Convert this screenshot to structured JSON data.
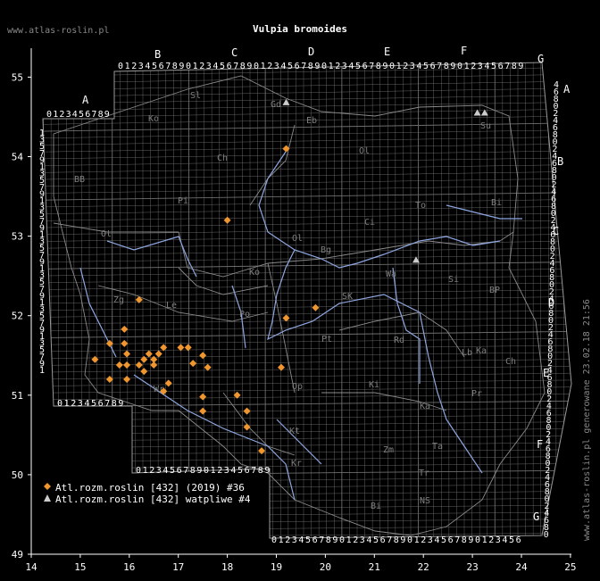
{
  "site": "www.atlas-roslin.pl",
  "title": "Vulpia bromoides",
  "generated": "www.atlas-roslin.pl generowane 23.02.18 21:56",
  "axes": {
    "x_ticks": [
      "14",
      "15",
      "16",
      "17",
      "18",
      "19",
      "20",
      "21",
      "22",
      "23",
      "24",
      "25"
    ],
    "y_ticks": [
      "49",
      "50",
      "51",
      "52",
      "53",
      "54",
      "55"
    ]
  },
  "grid": {
    "column_letters": [
      "A",
      "B",
      "C",
      "D",
      "E",
      "F",
      "G"
    ],
    "row_letters": [
      "A",
      "B",
      "C",
      "D",
      "E",
      "F",
      "G"
    ],
    "digits": [
      "0",
      "1",
      "2",
      "3",
      "4",
      "5",
      "6",
      "7",
      "8",
      "9"
    ]
  },
  "region_labels": [
    "Sl",
    "Gd",
    "Eb",
    "Ol",
    "Ko",
    "Ch",
    "Bi",
    "Pi",
    "Ci",
    "Su",
    "To",
    "Ot",
    "Ol",
    "Bg",
    "Wa",
    "Si",
    "BP",
    "Ko",
    "Po",
    "SK",
    "Zg",
    "Le",
    "Ka",
    "Pt",
    "Rd",
    "Lb",
    "Ch",
    "Wr",
    "Op",
    "Ki",
    "Ka",
    "Kt",
    "Ta",
    "Pr",
    "Zm",
    "Tr",
    "Bi",
    "NS",
    "Kr",
    "BB"
  ],
  "legend": {
    "confirmed": {
      "label": "Atl.rozm.roslin [432] (2019) #36",
      "color": "#f0962e"
    },
    "doubtful": {
      "label": "Atl.rozm.roslin [432] watpliwe #4",
      "color": "#cccccc"
    }
  },
  "records": {
    "confirmed": [
      [
        19.2,
        54.1
      ],
      [
        18.0,
        53.2
      ],
      [
        19.8,
        52.1
      ],
      [
        19.2,
        51.97
      ],
      [
        16.2,
        52.2
      ],
      [
        15.9,
        51.83
      ],
      [
        15.6,
        51.65
      ],
      [
        15.9,
        51.65
      ],
      [
        15.3,
        51.45
      ],
      [
        15.6,
        51.2
      ],
      [
        15.8,
        51.38
      ],
      [
        15.95,
        51.38
      ],
      [
        15.95,
        51.52
      ],
      [
        15.95,
        51.2
      ],
      [
        16.2,
        51.38
      ],
      [
        16.3,
        51.45
      ],
      [
        16.4,
        51.52
      ],
      [
        16.5,
        51.45
      ],
      [
        16.6,
        51.52
      ],
      [
        16.7,
        51.6
      ],
      [
        16.3,
        51.3
      ],
      [
        16.5,
        51.38
      ],
      [
        16.7,
        51.05
      ],
      [
        16.8,
        51.15
      ],
      [
        17.05,
        51.6
      ],
      [
        17.2,
        51.6
      ],
      [
        17.3,
        51.4
      ],
      [
        17.5,
        51.5
      ],
      [
        17.6,
        51.35
      ],
      [
        17.5,
        50.98
      ],
      [
        17.5,
        50.8
      ],
      [
        18.2,
        51.0
      ],
      [
        18.4,
        50.8
      ],
      [
        18.4,
        50.6
      ],
      [
        18.7,
        50.3
      ],
      [
        19.1,
        51.35
      ]
    ],
    "doubtful": [
      [
        19.2,
        54.68
      ],
      [
        23.1,
        54.55
      ],
      [
        23.25,
        54.55
      ],
      [
        21.85,
        52.7
      ]
    ]
  }
}
